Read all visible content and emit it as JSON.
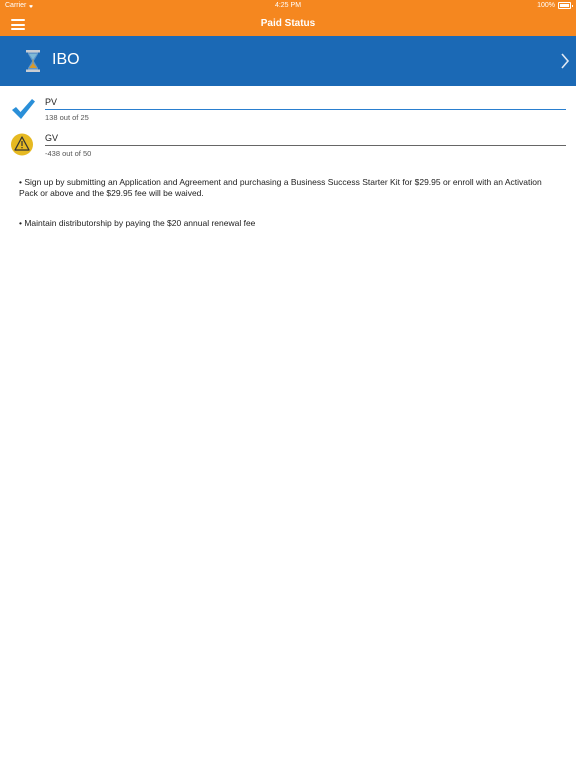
{
  "status_bar": {
    "carrier": "Carrier",
    "time": "4:25 PM",
    "battery": "100%"
  },
  "nav": {
    "title": "Paid Status"
  },
  "banner": {
    "title": "IBO"
  },
  "metrics": [
    {
      "label": "PV",
      "value": "138 out of 25",
      "status": "complete"
    },
    {
      "label": "GV",
      "value": "-438 out of 50",
      "status": "warning"
    }
  ],
  "requirements": [
    "• Sign up by submitting an Application and Agreement and purchasing a Business Success Starter Kit for $29.95 or enroll with an Activation Pack or above and the $29.95 fee will be waived.",
    "• Maintain distributorship by paying the $20 annual renewal fee"
  ],
  "colors": {
    "header_orange": "#f5871f",
    "banner_blue": "#1b69b5",
    "check_blue": "#2a8fd8",
    "warning_yellow": "#e6b922"
  },
  "icons": {
    "menu": "hamburger-menu-icon",
    "banner": "hourglass-icon",
    "banner_action": "chevron-right-icon",
    "complete": "checkmark-icon",
    "warning": "warning-icon"
  }
}
